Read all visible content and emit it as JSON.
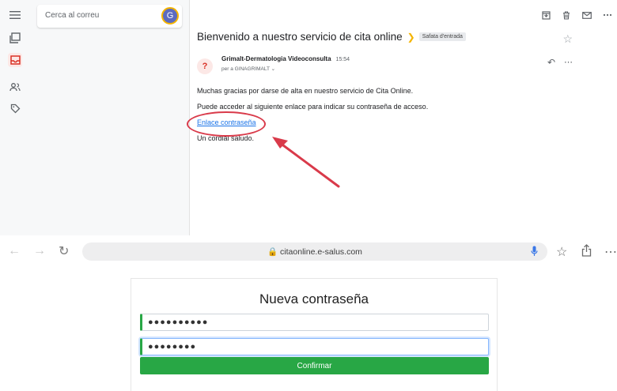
{
  "mail": {
    "search_placeholder": "Cerca al correu",
    "avatar_letter": "G",
    "subject": "Bienvenido a nuestro servicio de cita online",
    "label": "Safata d'entrada",
    "sender_name": "Grimalt-Dermatologia Videoconsulta",
    "time": "15:54",
    "to": "per a GINAGRIMALT",
    "sender_initial": "?",
    "body_line1": "Muchas gracias por darse de alta en nuestro servicio de Cita Online.",
    "body_line2": "Puede acceder al siguiente enlace para indicar su contraseña de acceso.",
    "link_text": "Enlace contraseña",
    "closing": "Un cordial saludo.",
    "highlight_color": "#d93a4a"
  },
  "browser": {
    "url": "citaonline.e-salus.com"
  },
  "form": {
    "title": "Nueva contraseña",
    "password1": "●●●●●●●●●●",
    "password2": "●●●●●●●●",
    "confirm_label": "Confirmar",
    "accent": "#28a745"
  }
}
